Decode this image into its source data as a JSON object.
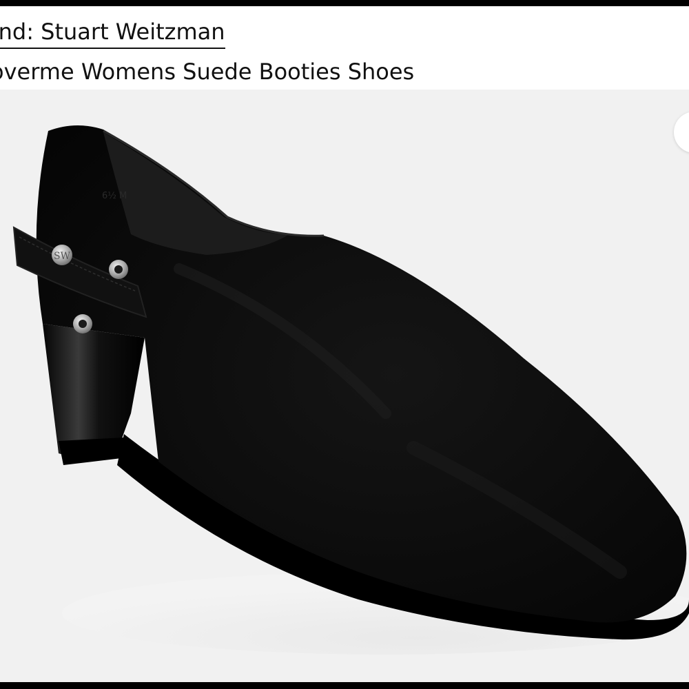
{
  "header": {
    "brand_text": "and: Stuart Weitzman",
    "title_text": "overme Womens Suede Booties Shoes"
  },
  "product_image": {
    "subject": "black suede bootie shoe with low heel",
    "heel_size_marking": "6½ M",
    "hardware_monogram": "SW"
  },
  "colors": {
    "page_border": "#000000",
    "image_background": "#f1f1f1",
    "shoe": "#0b0b0b",
    "hardware": "#c8c8c8"
  }
}
